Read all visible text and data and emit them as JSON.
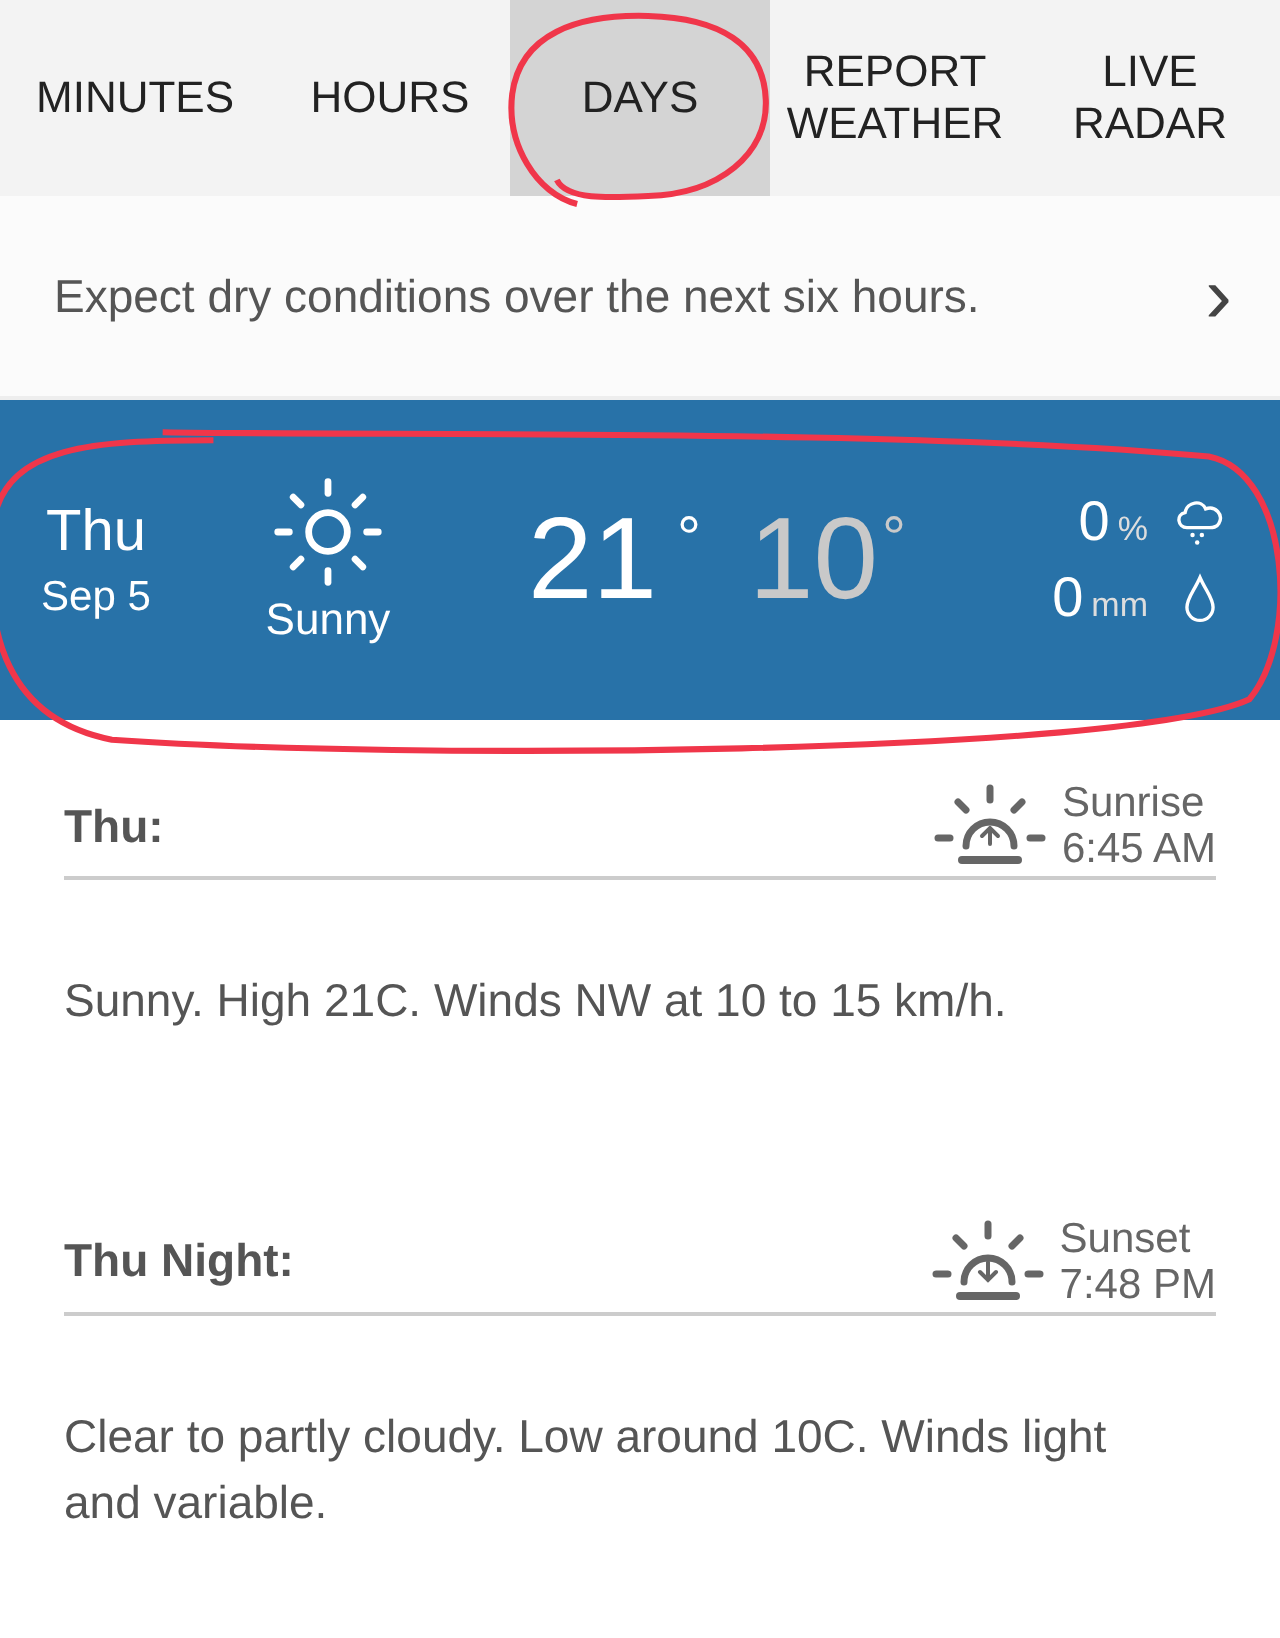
{
  "tabs": [
    {
      "label": "MINUTES",
      "selected": false,
      "circled": false
    },
    {
      "label": "HOURS",
      "selected": false,
      "circled": false
    },
    {
      "label": "DAYS",
      "selected": true,
      "circled": true
    },
    {
      "label": "REPORT\nWEATHER",
      "selected": false,
      "circled": false
    },
    {
      "label": "LIVE\nRADAR",
      "selected": false,
      "circled": false
    }
  ],
  "summary": {
    "text": "Expect dry conditions over the next six hours.",
    "chevron": "›"
  },
  "day": {
    "circled": true,
    "weekday": "Thu",
    "date": "Sep 5",
    "condition": "Sunny",
    "high": "21",
    "high_unit": "°",
    "low": "10",
    "low_unit": "°",
    "precip_chance": "0",
    "precip_chance_unit": "%",
    "precip_amount": "0",
    "precip_amount_unit": "mm"
  },
  "periods": [
    {
      "title": "Thu:",
      "kind": "sunrise",
      "event_label": "Sunrise",
      "event_time": "6:45 AM",
      "forecast": "Sunny. High 21C. Winds NW at 10 to 15 km/h."
    },
    {
      "title": "Thu Night:",
      "kind": "sunset",
      "event_label": "Sunset",
      "event_time": "7:48 PM",
      "forecast": "Clear to partly cloudy. Low around 10C. Winds light and variable."
    }
  ]
}
